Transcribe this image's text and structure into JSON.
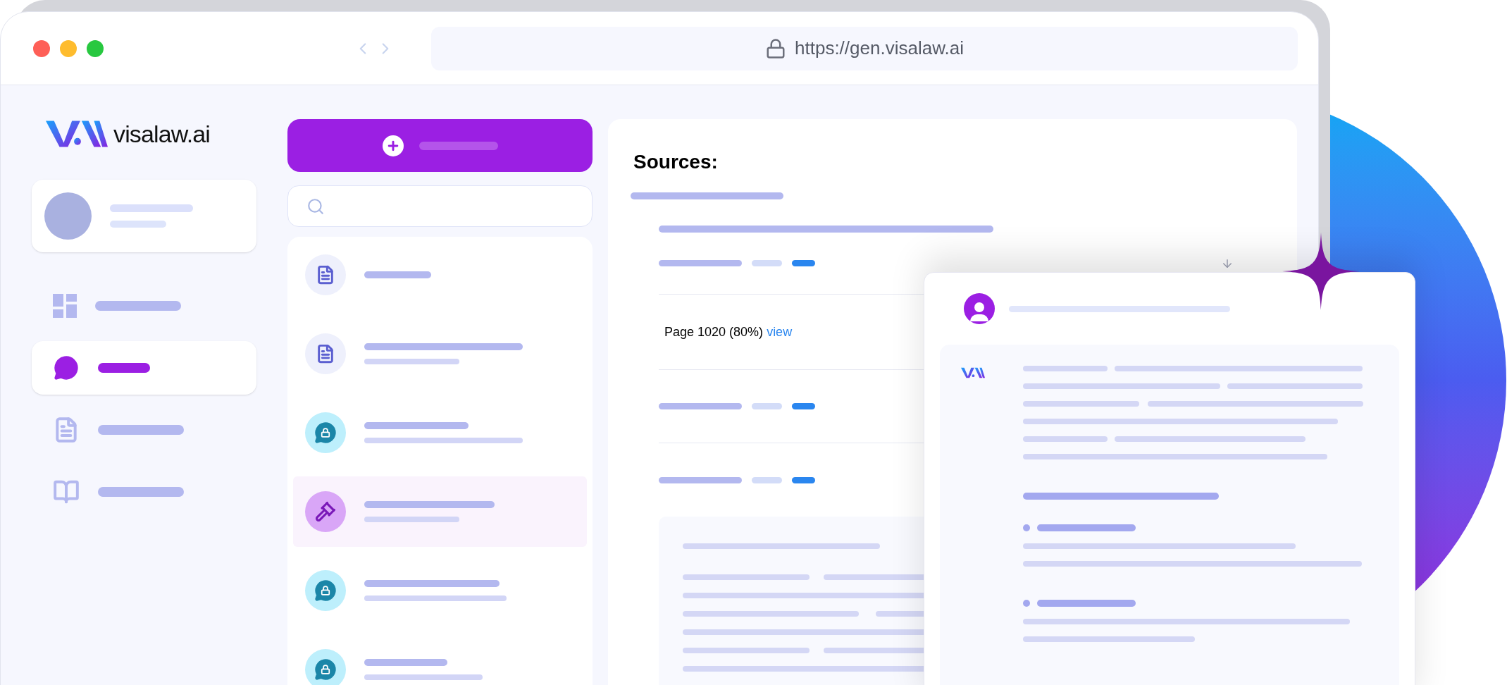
{
  "browser": {
    "url": "https://gen.visalaw.ai"
  },
  "sidebar": {
    "logo_text": "visalaw.ai",
    "nav_items": [
      {
        "kind": "dashboard",
        "selected": false
      },
      {
        "kind": "chat",
        "selected": true
      },
      {
        "kind": "document",
        "selected": false
      },
      {
        "kind": "book",
        "selected": false
      }
    ]
  },
  "conversations": [
    {
      "kind": "document",
      "selected": false
    },
    {
      "kind": "document",
      "selected": false
    },
    {
      "kind": "private-chat",
      "selected": false
    },
    {
      "kind": "gavel",
      "selected": true
    },
    {
      "kind": "private-chat",
      "selected": false
    },
    {
      "kind": "private-chat",
      "selected": false
    }
  ],
  "sources": {
    "title": "Sources:",
    "page_ref": "Page 1020 (80%)",
    "link": "view"
  }
}
